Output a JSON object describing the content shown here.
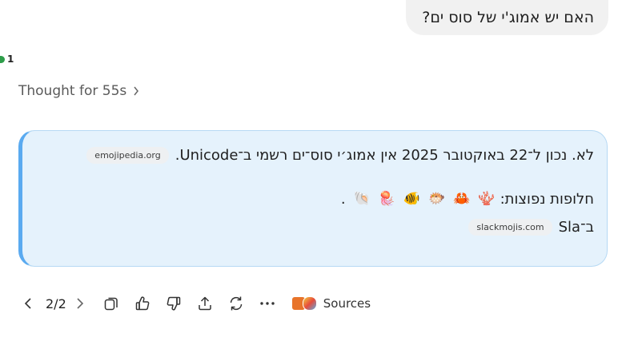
{
  "user_message": "האם יש אמוג'י של סוס ים?",
  "indicator": {
    "count": "1"
  },
  "thought": {
    "label": "Thought for 55s",
    "chevron_icon": "chevron-right-icon"
  },
  "answer": {
    "line1": "לא. נכון ל־22 באוקטובר 2025 אין אמוג׳י סוס־ים רשמי ב־Unicode.",
    "line1_source": "emojipedia.org",
    "line2": "חלופות נפוצות:",
    "emojis": [
      "🪸",
      "🦀",
      "🐡",
      "🐠",
      "🪼",
      "🐚"
    ],
    "emoji_trail": ".",
    "line3": "ב־Sla",
    "line3_source": "slackmojis.com"
  },
  "toolbar": {
    "prev_icon": "chevron-left-icon",
    "pager": "2/2",
    "next_icon": "chevron-right-icon",
    "copy_icon": "copy-icon",
    "like_icon": "thumbs-up-icon",
    "dislike_icon": "thumbs-down-icon",
    "share_icon": "share-icon",
    "regenerate_icon": "regenerate-icon",
    "more_icon": "more-icon",
    "sources_label": "Sources"
  },
  "colors": {
    "accent": "#5aaaf0",
    "card_bg": "#e5f2fc",
    "user_bubble": "#f1f1f1",
    "status_dot": "#2e9d4a"
  }
}
